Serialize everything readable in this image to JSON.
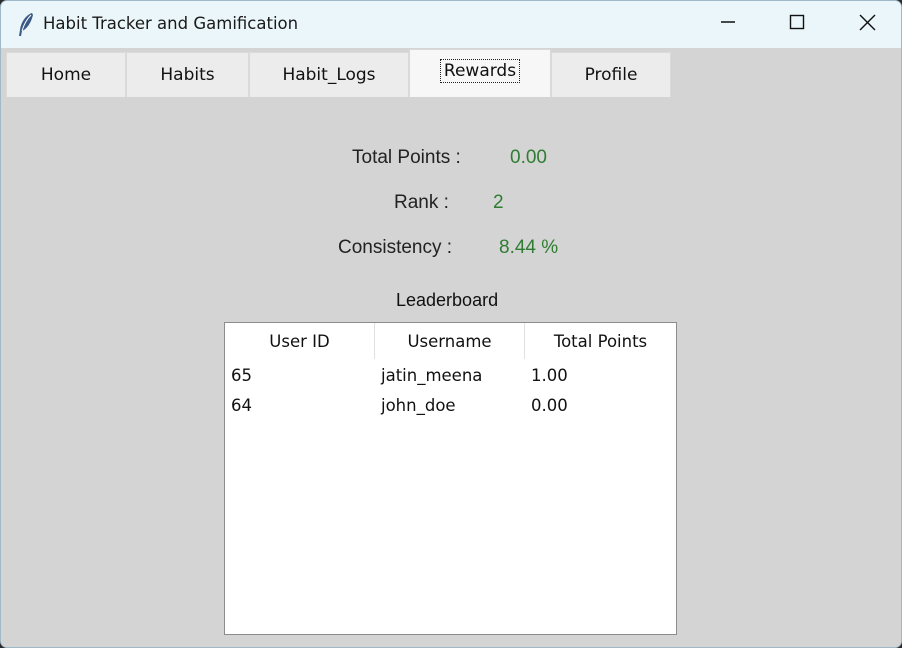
{
  "window": {
    "title": "Habit Tracker and Gamification"
  },
  "tabs": [
    {
      "label": "Home"
    },
    {
      "label": "Habits"
    },
    {
      "label": "Habit_Logs"
    },
    {
      "label": "Rewards",
      "active": true
    },
    {
      "label": "Profile"
    }
  ],
  "stats": {
    "total_points_label": "Total Points :",
    "total_points_value": "0.00",
    "rank_label": "Rank :",
    "rank_value": "2",
    "consistency_label": "Consistency :",
    "consistency_value": "8.44 %",
    "value_color": "#2e7d32"
  },
  "leaderboard": {
    "title": "Leaderboard",
    "columns": [
      "User ID",
      "Username",
      "Total Points"
    ],
    "rows": [
      [
        "65",
        "jatin_meena",
        "1.00"
      ],
      [
        "64",
        "john_doe",
        "0.00"
      ]
    ]
  },
  "icons": {
    "app": "feather-icon",
    "minimize": "minimize-icon",
    "maximize": "maximize-icon",
    "close": "close-icon"
  }
}
